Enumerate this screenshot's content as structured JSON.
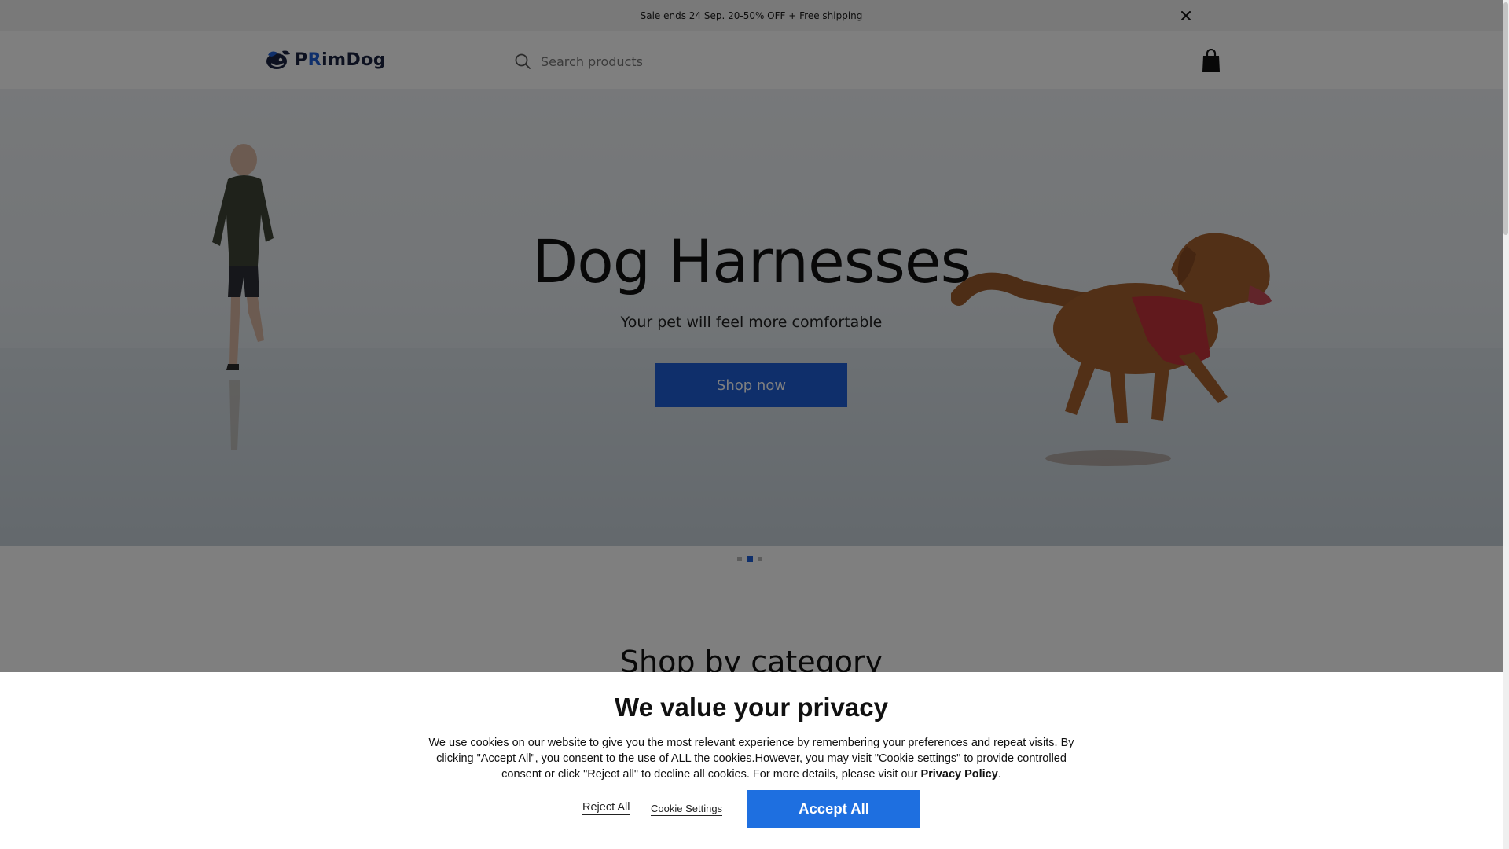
{
  "announcement": {
    "text": "Sale ends 24 Sep. 20-50% OFF + Free shipping",
    "close_icon": "close-icon"
  },
  "header": {
    "logo_prefix": "P",
    "logo_accent": "R",
    "logo_suffix": "imDog",
    "search_placeholder": "Search products",
    "search_value": "",
    "cart_icon": "shopping-bag-icon"
  },
  "hero": {
    "title": "Dog Harnesses",
    "subtitle": "Your pet will feel more comfortable",
    "cta_label": "Shop now",
    "slides_total": 3,
    "active_slide": 2
  },
  "section": {
    "title": "Shop by category"
  },
  "cookie_banner": {
    "title": "We value your privacy",
    "body": "We use cookies on our website to give you the most relevant experience by remembering your preferences and repeat visits. By clicking \"Accept All\", you consent to the use of ALL the cookies.However, you may visit \"Cookie settings\" to provide controlled consent or click \"Reject all\" to decline all cookies. For more details, please visit our ",
    "privacy_link": "Privacy Policy",
    "body_end": ".",
    "reject_label": "Reject All",
    "settings_label": "Cookie Settings",
    "accept_label": "Accept All"
  },
  "colors": {
    "brand_blue": "#1e5fd6",
    "accept_blue": "#1e6fe0",
    "overlay": "rgba(0,0,0,0.5)"
  }
}
